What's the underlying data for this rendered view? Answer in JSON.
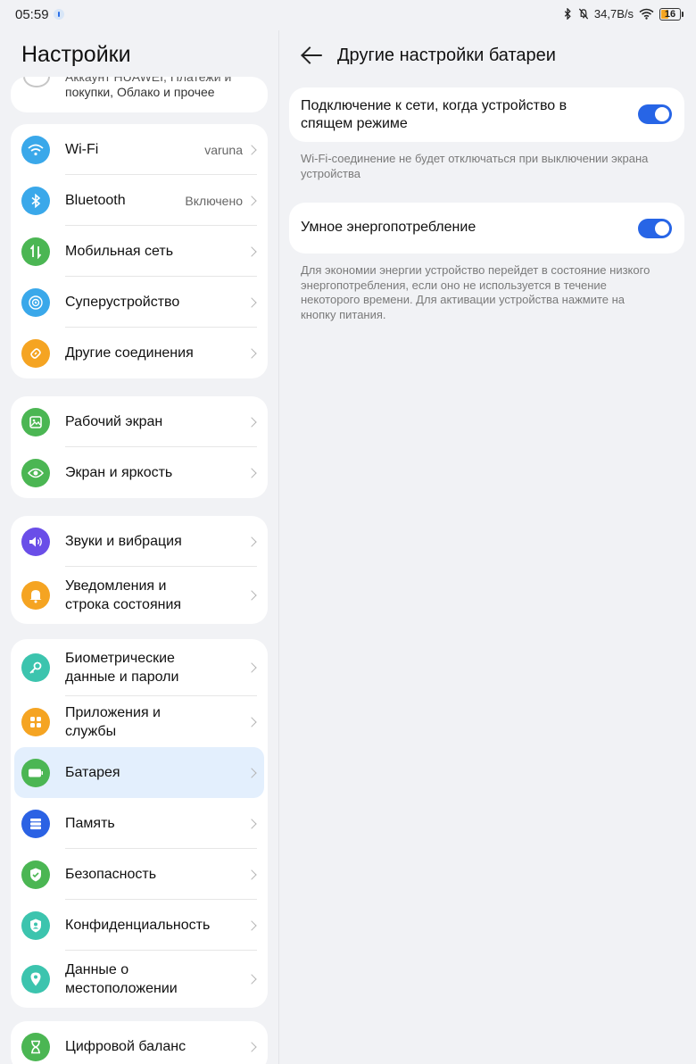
{
  "status_bar": {
    "time": "05:59",
    "network_speed": "34,7B/s",
    "battery_level": "16",
    "icons": [
      "bluetooth-icon",
      "mute-icon",
      "wifi-icon",
      "battery-icon"
    ]
  },
  "left_panel": {
    "title": "Настройки",
    "account": {
      "line1": "Аккаунт HUAWEI, Платежи и",
      "line2": "покупки, Облако и прочее"
    },
    "groups": [
      {
        "items": [
          {
            "label": "Wi-Fi",
            "value": "varuna",
            "icon": "wifi-icon",
            "color": "#3aa8ea"
          },
          {
            "label": "Bluetooth",
            "value": "Включено",
            "icon": "bluetooth-icon",
            "color": "#3aa8ea"
          },
          {
            "label": "Мобильная сеть",
            "value": "",
            "icon": "mobile-data-icon",
            "color": "#4bb653"
          },
          {
            "label": "Суперустройство",
            "value": "",
            "icon": "super-device-icon",
            "color": "#3aa8ea"
          },
          {
            "label": "Другие соединения",
            "value": "",
            "icon": "link-icon",
            "color": "#f5a422"
          }
        ]
      },
      {
        "items": [
          {
            "label": "Рабочий экран",
            "icon": "home-screen-icon",
            "color": "#4bb653"
          },
          {
            "label": "Экран и яркость",
            "icon": "eye-icon",
            "color": "#4bb653"
          }
        ]
      },
      {
        "items": [
          {
            "label": "Звуки и вибрация",
            "icon": "sound-icon",
            "color": "#6a4ee8"
          },
          {
            "label": "Уведомления и строка состояния",
            "icon": "bell-icon",
            "color": "#f5a422"
          }
        ]
      },
      {
        "items": [
          {
            "label": "Биометрические данные и пароли",
            "icon": "key-icon",
            "color": "#3cc4ae"
          },
          {
            "label": "Приложения и службы",
            "icon": "apps-icon",
            "color": "#f5a422"
          },
          {
            "label": "Батарея",
            "icon": "battery-icon",
            "color": "#4bb653",
            "selected": true
          },
          {
            "label": "Память",
            "icon": "storage-icon",
            "color": "#2b62e4"
          },
          {
            "label": "Безопасность",
            "icon": "shield-icon",
            "color": "#4bb653"
          },
          {
            "label": "Конфиденциальность",
            "icon": "privacy-icon",
            "color": "#3cc4ae"
          },
          {
            "label": "Данные о местоположении",
            "icon": "location-icon",
            "color": "#3cc4ae"
          }
        ]
      },
      {
        "items": [
          {
            "label": "Цифровой баланс",
            "icon": "hourglass-icon",
            "color": "#4bb653"
          }
        ]
      }
    ]
  },
  "right_panel": {
    "title": "Другие настройки батареи",
    "settings": [
      {
        "label": "Подключение к сети, когда устройство в спящем режиме",
        "enabled": true,
        "description": "Wi-Fi-соединение не будет отключаться при выключении экрана устройства"
      },
      {
        "label": "Умное энергопотребление",
        "enabled": true,
        "description": "Для экономии энергии устройство перейдет в состояние низкого энергопотребления, если оно не используется в течение некоторого времени. Для активации устройства нажмите на кнопку питания."
      }
    ]
  },
  "colors": {
    "accent": "#2765e6",
    "background": "#f1f2f5",
    "selected_row": "#e3effd"
  }
}
